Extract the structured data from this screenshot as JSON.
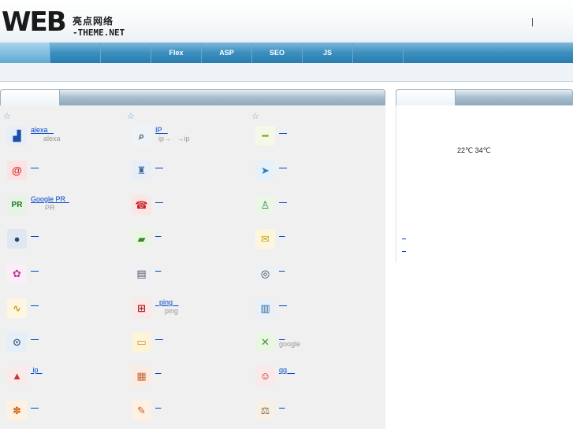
{
  "header": {
    "logo_main": "WEB",
    "logo_cn": "亮点网络",
    "logo_sub": "-THEME.NET",
    "separator": "|"
  },
  "nav": {
    "tabs": [
      {
        "label": ""
      },
      {
        "label": ""
      },
      {
        "label": ""
      },
      {
        "label": "Flex"
      },
      {
        "label": "ASP"
      },
      {
        "label": "SEO"
      },
      {
        "label": "JS"
      },
      {
        "label": ""
      }
    ]
  },
  "main": {
    "columns": [
      {
        "items": [
          {
            "icon": "bar-chart-icon",
            "link": "alexa   ",
            "sub": "alexa"
          },
          {
            "icon": "snail-icon",
            "link": "    ",
            "sub": ""
          },
          {
            "icon": "pagerank-icon",
            "link": "Google PR  ",
            "sub": "PR"
          },
          {
            "icon": "com-domain-icon",
            "link": "    ",
            "sub": ""
          },
          {
            "icon": "balloons-icon",
            "link": "    ",
            "sub": ""
          },
          {
            "icon": "ribbon-icon",
            "link": "    ",
            "sub": ""
          },
          {
            "icon": "padlock-icon",
            "link": "    ",
            "sub": ""
          },
          {
            "icon": "party-hats-icon",
            "link": " ip  ",
            "sub": ""
          },
          {
            "icon": "bouquet-icon",
            "link": "    ",
            "sub": ""
          }
        ]
      },
      {
        "items": [
          {
            "icon": "magnifier-icon",
            "link": "IP   ",
            "sub": "ip→   →ip"
          },
          {
            "icon": "paint-bottle-icon",
            "link": "    ",
            "sub": ""
          },
          {
            "icon": "telephone-icon",
            "link": "    ",
            "sub": ""
          },
          {
            "icon": "truck-icon",
            "link": "   ",
            "sub": ""
          },
          {
            "icon": "printer-icon",
            "link": "   ",
            "sub": ""
          },
          {
            "icon": "network-icon",
            "link": "  ping   ",
            "sub": "ping"
          },
          {
            "icon": "coins-icon",
            "link": "    ",
            "sub": ""
          },
          {
            "icon": "boxes-icon",
            "link": "   ",
            "sub": ""
          },
          {
            "icon": "books-icon",
            "link": "   ",
            "sub": ""
          }
        ]
      },
      {
        "items": [
          {
            "icon": "ruler-car-icon",
            "link": "    ",
            "sub": ""
          },
          {
            "icon": "airplane-icon",
            "link": "    ",
            "sub": ""
          },
          {
            "icon": "user-icon",
            "link": "    ",
            "sub": ""
          },
          {
            "icon": "envelope-icon",
            "link": "   ",
            "sub": ""
          },
          {
            "icon": "compass-icon",
            "link": "   ",
            "sub": ""
          },
          {
            "icon": "color-books-icon",
            "link": "    ",
            "sub": ""
          },
          {
            "icon": "satellite-icon",
            "link": "   ",
            "sub": "google"
          },
          {
            "icon": "qq-icon",
            "link": "qq    ",
            "sub": ""
          },
          {
            "icon": "scales-icon",
            "link": "   ",
            "sub": ""
          }
        ]
      }
    ]
  },
  "side": {
    "weather": "22℃ 34℃",
    "links": [
      "  ",
      "  "
    ]
  }
}
